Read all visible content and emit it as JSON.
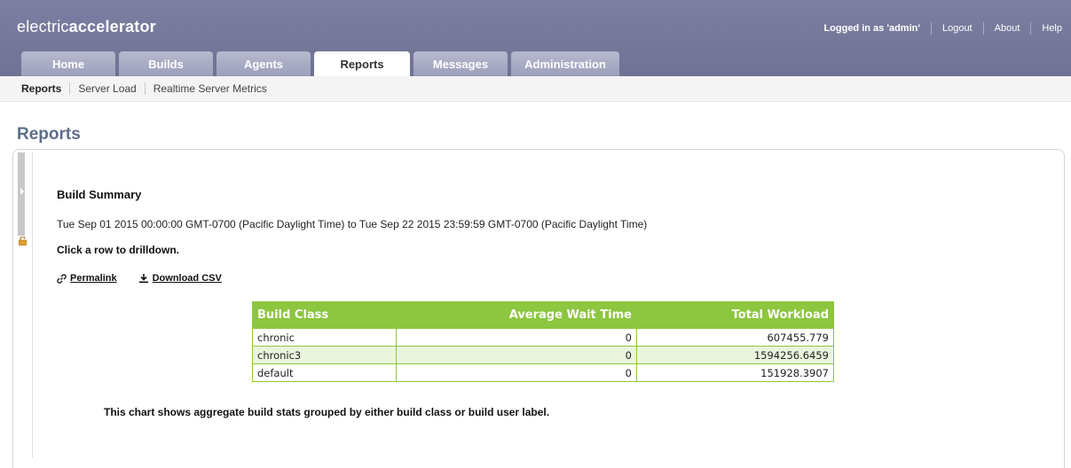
{
  "header": {
    "logo_light": "electric",
    "logo_bold": "accelerator",
    "user_text": "Logged in as 'admin'",
    "links": [
      "Logout",
      "About",
      "Help"
    ]
  },
  "tabs": [
    {
      "label": "Home",
      "active": false
    },
    {
      "label": "Builds",
      "active": false
    },
    {
      "label": "Agents",
      "active": false
    },
    {
      "label": "Reports",
      "active": true
    },
    {
      "label": "Messages",
      "active": false
    },
    {
      "label": "Administration",
      "active": false
    }
  ],
  "subnav": [
    "Reports",
    "Server Load",
    "Realtime Server Metrics"
  ],
  "page_title": "Reports",
  "report": {
    "title": "Build Summary",
    "date_range": "Tue Sep 01 2015 00:00:00 GMT-0700 (Pacific Daylight Time) to Tue Sep 22 2015 23:59:59 GMT-0700 (Pacific Daylight Time)",
    "instruction": "Click a row to drilldown.",
    "permalink_label": "Permalink",
    "download_label": "Download CSV",
    "table": {
      "headers": [
        "Build Class",
        "Average Wait Time",
        "Total Workload"
      ],
      "rows": [
        [
          "chronic",
          "0",
          "607455.779"
        ],
        [
          "chronic3",
          "0",
          "1594256.6459"
        ],
        [
          "default",
          "0",
          "151928.3907"
        ]
      ]
    },
    "caption": "This chart shows aggregate build stats grouped by either build class or build user label."
  },
  "colors": {
    "header_bg": "#7c7fa1",
    "table_header": "#8dc63f",
    "table_alt_row": "#ebf4dd",
    "page_title": "#5e6e8a"
  }
}
